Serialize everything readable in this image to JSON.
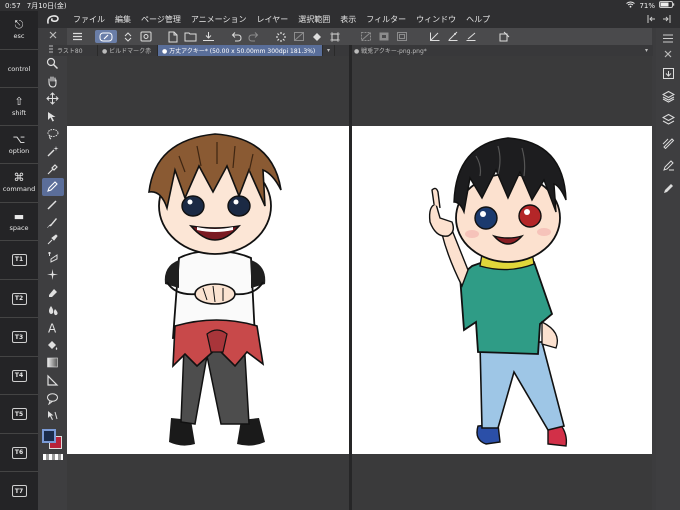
{
  "status_bar": {
    "time": "0:57",
    "date": "7月10日(金)",
    "battery": "71%"
  },
  "menu": {
    "items": [
      "ファイル",
      "編集",
      "ページ管理",
      "アニメーション",
      "レイヤー",
      "選択範囲",
      "表示",
      "フィルター",
      "ウィンドウ",
      "ヘルプ"
    ]
  },
  "modifier_keys": [
    {
      "symbol": "⎋",
      "label": "esc"
    },
    {
      "symbol": "",
      "label": "control"
    },
    {
      "symbol": "⇧",
      "label": "shift"
    },
    {
      "symbol": "⌥",
      "label": "option"
    },
    {
      "symbol": "⌘",
      "label": "command"
    },
    {
      "symbol": "▬",
      "label": "space"
    },
    {
      "symbol": "",
      "label": "T1"
    },
    {
      "symbol": "",
      "label": "T2"
    },
    {
      "symbol": "",
      "label": "T3"
    },
    {
      "symbol": "",
      "label": "T4"
    },
    {
      "symbol": "",
      "label": "T5"
    },
    {
      "symbol": "",
      "label": "T6"
    },
    {
      "symbol": "",
      "label": "T7"
    }
  ],
  "tabs": [
    {
      "label": "ラスト80"
    },
    {
      "label": "● ビルドマーク赤"
    },
    {
      "label": "● 万丈アクキー* (50.00 x 50.00mm 300dpi 181.3%)",
      "active": true
    },
    {
      "label": "● 戦兎アクキー-png.png*"
    }
  ],
  "colors": {
    "accent": "#596e9a",
    "main_color": "#1a2b4a",
    "sub_color": "#b8223a",
    "canvas": "#ffffff",
    "workspace": "#3a3a3b"
  }
}
